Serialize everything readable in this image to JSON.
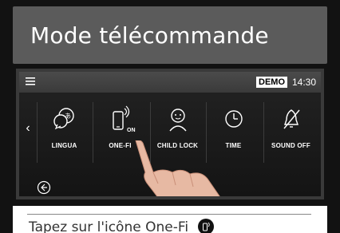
{
  "header": {
    "title": "Mode télécommande"
  },
  "device": {
    "status": {
      "demo_badge": "DEMO",
      "time": "14:30"
    },
    "tiles": [
      {
        "label": "LINGUA",
        "icon": "language-icon"
      },
      {
        "label": "ONE-FI",
        "icon": "phone-wifi-icon",
        "sub_label": "ON"
      },
      {
        "label": "CHILD LOCK",
        "icon": "child-lock-icon"
      },
      {
        "label": "TIME",
        "icon": "clock-icon"
      },
      {
        "label": "SOUND OFF",
        "icon": "sound-off-icon"
      }
    ]
  },
  "caption": {
    "text": "Tapez sur l'icône One-Fi"
  },
  "colors": {
    "header_bg": "#5b5b5b",
    "screen_bg": "#1a1a1a",
    "text": "#ffffff"
  }
}
